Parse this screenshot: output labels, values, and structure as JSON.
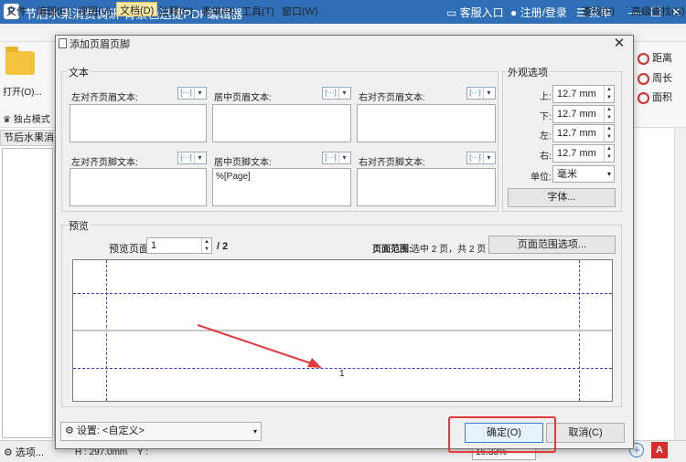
{
  "window": {
    "title": "节后水果消费调研-背景色迅捷PDF编辑器",
    "customer_service": "客服入口",
    "login": "注册/登录",
    "menu": "菜单",
    "minimize": "—",
    "maximize": "☐",
    "close": "✕"
  },
  "menubar": {
    "items": [
      "文件",
      "编辑(E)",
      "视图(V)",
      "文档(D)",
      "注释(C)",
      "表单(R)",
      "工具(T)",
      "窗口(W)"
    ],
    "right_items": [
      "查找(F)",
      "高级查找(S)"
    ]
  },
  "toolbar": {
    "open_label": "打开(O)...",
    "exclusive_mode": "独占模式",
    "distance": "距离",
    "perimeter": "周长",
    "area": "面积"
  },
  "document": {
    "tab_label": "节后水果消费",
    "status_h": "H : 297.0mm",
    "status_y": "Y :",
    "zoom": "16.33%",
    "options": "选项..."
  },
  "dialog": {
    "title": "添加页眉页脚",
    "text_group": "文本",
    "header_left_label": "左对齐页眉文本:",
    "header_center_label": "居中页眉文本:",
    "header_right_label": "右对齐页眉文本:",
    "footer_left_label": "左对齐页脚文本:",
    "footer_center_label": "居中页脚文本:",
    "footer_right_label": "右对齐页脚文本:",
    "header_left_value": "",
    "header_center_value": "",
    "header_right_value": "",
    "footer_left_value": "",
    "footer_center_value": "%[Page]",
    "footer_right_value": "",
    "appearance_group": "外观选项",
    "margin_top_label": "上:",
    "margin_top_value": "12.7 mm",
    "margin_bottom_label": "下:",
    "margin_bottom_value": "12.7 mm",
    "margin_left_label": "左:",
    "margin_left_value": "12.7 mm",
    "margin_right_label": "右:",
    "margin_right_value": "12.7 mm",
    "unit_label": "单位:",
    "unit_value": "毫米",
    "font_button": "字体...",
    "preview_group": "预览",
    "preview_page_label": "预览页面",
    "preview_page_value": "1",
    "preview_page_total": "/ 2",
    "page_range_label": "页面范围:",
    "page_range_text": "选中 2 页，共 2 页",
    "page_range_button": "页面范围选项...",
    "preview_footer_text": "1",
    "settings_label": "设置:",
    "settings_value": "<自定义>",
    "ok_button": "确定(O)",
    "cancel_button": "取消(C)"
  },
  "colors": {
    "titlebar": "#2f6fb8",
    "annotation_red": "#e03a3a",
    "guide_lines": "#4040c8"
  }
}
